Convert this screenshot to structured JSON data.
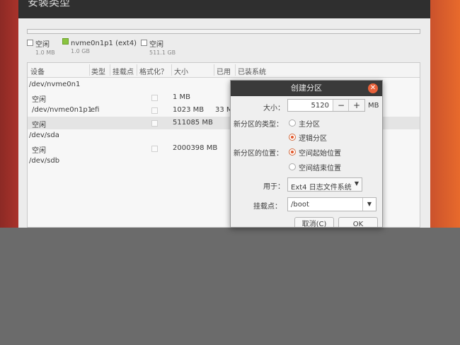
{
  "window": {
    "title": "安装类型"
  },
  "legend": [
    {
      "name": "空闲",
      "size": "1.0 MB",
      "color": "#ffffff"
    },
    {
      "name": "nvme0n1p1 (ext4)",
      "size": "1.0 GB",
      "color": "#8ac43f"
    },
    {
      "name": "空闲",
      "size": "511.1 GB",
      "color": "#ffffff"
    }
  ],
  "table": {
    "headers": [
      "设备",
      "类型",
      "挂载点",
      "格式化？",
      "大小",
      "已用",
      "已装系统"
    ],
    "rows": [
      {
        "device": "/dev/nvme0n1",
        "type": "",
        "mount": "",
        "size": "",
        "used": ""
      },
      {
        "device": "空闲",
        "type": "",
        "mount": "",
        "size": "1 MB",
        "used": ""
      },
      {
        "device": "/dev/nvme0n1p1",
        "type": "efi",
        "mount": "",
        "size": "1023 MB",
        "used": "33 M"
      },
      {
        "device": "空闲",
        "type": "",
        "mount": "",
        "size": "511085 MB",
        "used": ""
      },
      {
        "device": "/dev/sda",
        "type": "",
        "mount": "",
        "size": "",
        "used": ""
      },
      {
        "device": "空闲",
        "type": "",
        "mount": "",
        "size": "2000398 MB",
        "used": ""
      },
      {
        "device": "/dev/sdb",
        "type": "",
        "mount": "",
        "size": "",
        "used": ""
      }
    ]
  },
  "dialog": {
    "title": "创建分区",
    "size_label": "大小：",
    "size_value": "5120",
    "size_minus": "−",
    "size_plus": "+",
    "size_unit": "MB",
    "type_label": "新分区的类型：",
    "type_options": [
      "主分区",
      "逻辑分区"
    ],
    "type_selected": 1,
    "location_label": "新分区的位置：",
    "location_options": [
      "空间起始位置",
      "空间结束位置"
    ],
    "location_selected": 0,
    "use_as_label": "用于：",
    "use_as_value": "Ext4 日志文件系统",
    "mount_label": "挂载点：",
    "mount_value": "/boot",
    "cancel": "取消(C)",
    "ok": "OK"
  },
  "colors": {
    "accent": "#e2572a",
    "dialog_title_bg": "#3a3a3a"
  }
}
